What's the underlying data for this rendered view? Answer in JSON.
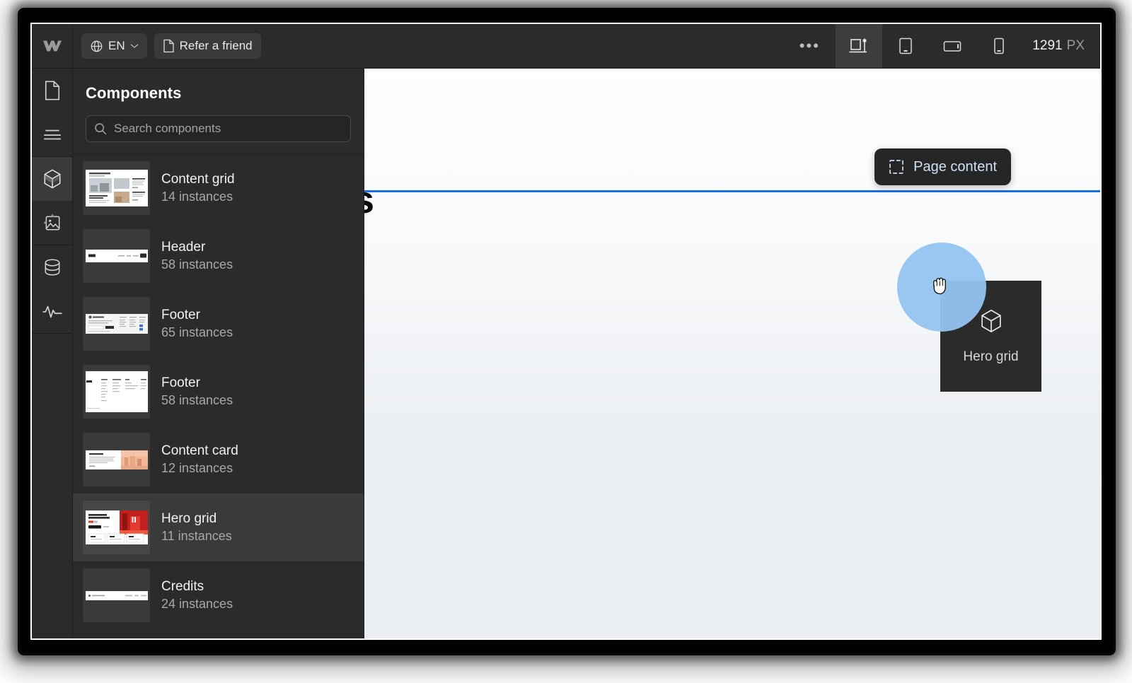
{
  "app": {
    "name": "Webflow Designer",
    "logo_icon": "webflow-logo-icon"
  },
  "topbar": {
    "language_button": {
      "label": "EN",
      "icon": "globe-icon",
      "chevron_icon": "chevron-down-icon"
    },
    "refer_button": {
      "label": "Refer a friend",
      "icon": "document-icon"
    },
    "more_button": {
      "label": "•••",
      "icon": "more-horizontal-icon"
    },
    "breakpoints": [
      {
        "name": "desktop-breakpoint",
        "icon": "desktop-asterisk-icon",
        "active": true
      },
      {
        "name": "tablet-breakpoint",
        "icon": "tablet-portrait-icon",
        "active": false
      },
      {
        "name": "mobile-landscape-breakpoint",
        "icon": "mobile-landscape-icon",
        "active": false
      },
      {
        "name": "mobile-portrait-breakpoint",
        "icon": "mobile-portrait-icon",
        "active": false
      }
    ],
    "viewport": {
      "value": "1291",
      "unit": "PX"
    }
  },
  "rail": {
    "items": [
      {
        "name": "pages-panel",
        "icon": "page-icon",
        "active": false
      },
      {
        "name": "navigator-panel",
        "icon": "navigator-lines-icon",
        "active": false
      },
      {
        "name": "components-panel",
        "icon": "cube-icon",
        "active": true
      },
      {
        "name": "assets-panel",
        "icon": "image-icon",
        "active": false
      },
      {
        "name": "cms-panel",
        "icon": "database-icon",
        "active": false
      },
      {
        "name": "audit-panel",
        "icon": "activity-pulse-icon",
        "active": false
      }
    ]
  },
  "panel": {
    "title": "Components",
    "search": {
      "placeholder": "Search components",
      "value": "",
      "icon": "search-icon"
    },
    "components": [
      {
        "name": "Content grid",
        "count": "14 instances",
        "thumb": "content-grid-thumb",
        "selected": false
      },
      {
        "name": "Header",
        "count": "58 instances",
        "thumb": "header-thumb",
        "selected": false
      },
      {
        "name": "Footer",
        "count": "65 instances",
        "thumb": "footer-dark-thumb",
        "selected": false
      },
      {
        "name": "Footer",
        "count": "58 instances",
        "thumb": "footer-light-thumb",
        "selected": false
      },
      {
        "name": "Content card",
        "count": "12 instances",
        "thumb": "content-card-thumb",
        "selected": false
      },
      {
        "name": "Hero grid",
        "count": "11 instances",
        "thumb": "hero-grid-thumb",
        "selected": true
      },
      {
        "name": "Credits",
        "count": "24 instances",
        "thumb": "credits-thumb",
        "selected": false
      }
    ]
  },
  "canvas": {
    "obscured_heading": "s",
    "page_badge": {
      "label": "Page content",
      "icon": "dashed-square-icon"
    },
    "drop_indicator": {
      "name": "drop-position-line",
      "color": "#1a6fe8"
    },
    "drag_ghost": {
      "label": "Hero grid",
      "icon": "cube-icon"
    },
    "cursor": {
      "icon": "grabbing-hand-cursor",
      "halo_color": "#94c4f0"
    }
  }
}
